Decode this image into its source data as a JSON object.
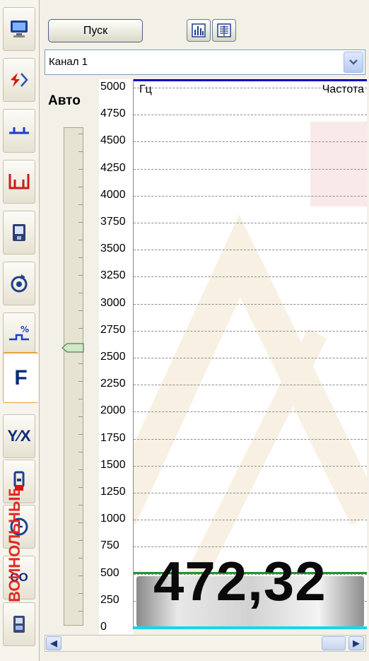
{
  "sidebar": {
    "tabs": [
      {
        "icon": "monitor-icon"
      },
      {
        "icon": "voltage-arrows-icon"
      },
      {
        "icon": "blue-pulse-icon"
      },
      {
        "icon": "red-pulse-icon"
      },
      {
        "icon": "data-logger-icon"
      },
      {
        "icon": "rotation-icon"
      },
      {
        "icon": "percent-trend-icon"
      },
      {
        "icon": "f-icon",
        "glyph": "F"
      },
      {
        "icon": "y-over-x-icon",
        "glyph": "Y⁄X"
      },
      {
        "icon": "probe-icon"
      },
      {
        "icon": "clock-icon"
      },
      {
        "icon": "co-icon",
        "glyph": "CO"
      },
      {
        "icon": "device-icon"
      }
    ],
    "active_tab": 7,
    "side_text": "ВОИНОЛЬНЫЕ"
  },
  "toolbar": {
    "start_label": "Пуск",
    "chart_icon": "bar-chart-icon",
    "table_icon": "table-icon"
  },
  "channel": {
    "selected": "Канал 1"
  },
  "slider": {
    "label": "Авто",
    "level": 0.5
  },
  "scale": {
    "ticks": [
      "5000",
      "4750",
      "4500",
      "4250",
      "4000",
      "3750",
      "3500",
      "3250",
      "3000",
      "2750",
      "2500",
      "2250",
      "2000",
      "1750",
      "1500",
      "1250",
      "1000",
      "750",
      "500",
      "250",
      "0"
    ]
  },
  "chart": {
    "unit": "Гц",
    "param": "Частота",
    "min": 0,
    "max": 5000,
    "value_display": "472,32",
    "value": 472.32,
    "colors": {
      "top": "#0000cc",
      "marker": "#1a9b2a",
      "base": "#19d6e6"
    }
  }
}
